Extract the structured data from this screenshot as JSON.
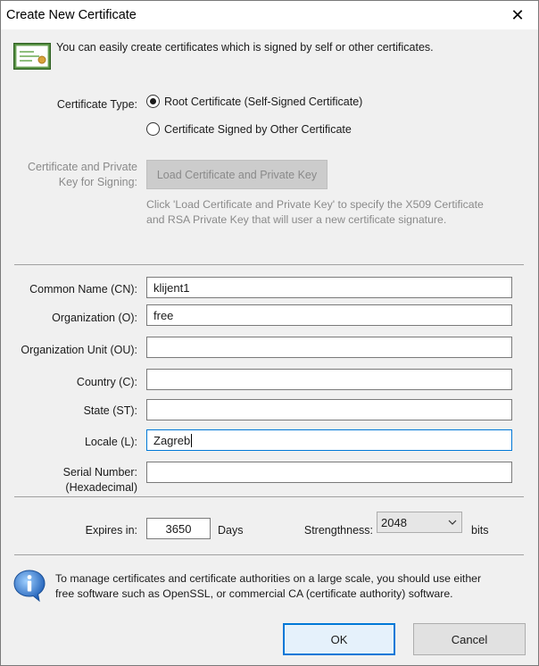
{
  "window": {
    "title": "Create New Certificate",
    "close_glyph": "✕"
  },
  "intro": {
    "icon": "certificate-icon",
    "text": "You can easily create certificates which is signed by self or other certificates."
  },
  "certificate_type": {
    "label": "Certificate Type:",
    "options": [
      {
        "label": "Root Certificate (Self-Signed Certificate)",
        "checked": true
      },
      {
        "label": "Certificate Signed by Other Certificate",
        "checked": false
      }
    ]
  },
  "signing": {
    "label_line1": "Certificate and Private",
    "label_line2": "Key for Signing:",
    "load_button": "Load Certificate and Private Key",
    "hint_line1": "Click 'Load Certificate and Private Key' to specify the X509 Certificate",
    "hint_line2": "and RSA Private Key that will user a new certificate signature."
  },
  "fields": {
    "common_name": {
      "label": "Common Name (CN):",
      "value": "klijent1"
    },
    "organization": {
      "label": "Organization (O):",
      "value": "free"
    },
    "org_unit": {
      "label": "Organization Unit (OU):",
      "value": ""
    },
    "country": {
      "label": "Country (C):",
      "value": ""
    },
    "state": {
      "label": "State (ST):",
      "value": ""
    },
    "locale": {
      "label": "Locale (L):",
      "value": "Zagreb"
    },
    "serial": {
      "label_line1": "Serial Number:",
      "label_line2": "(Hexadecimal)",
      "value": ""
    }
  },
  "expiry": {
    "label": "Expires in:",
    "value": "3650",
    "unit": "Days"
  },
  "strength": {
    "label": "Strengthness:",
    "selected": "2048",
    "unit": "bits"
  },
  "footer": {
    "icon": "info-icon",
    "text_line1": "To manage certificates and certificate authorities on a large scale, you should use either",
    "text_line2": "free software such as OpenSSL, or commercial CA (certificate authority) software."
  },
  "buttons": {
    "ok": "OK",
    "cancel": "Cancel"
  },
  "colors": {
    "focus_accent": "#0078d7",
    "dialog_bg": "#f0f0f0"
  }
}
